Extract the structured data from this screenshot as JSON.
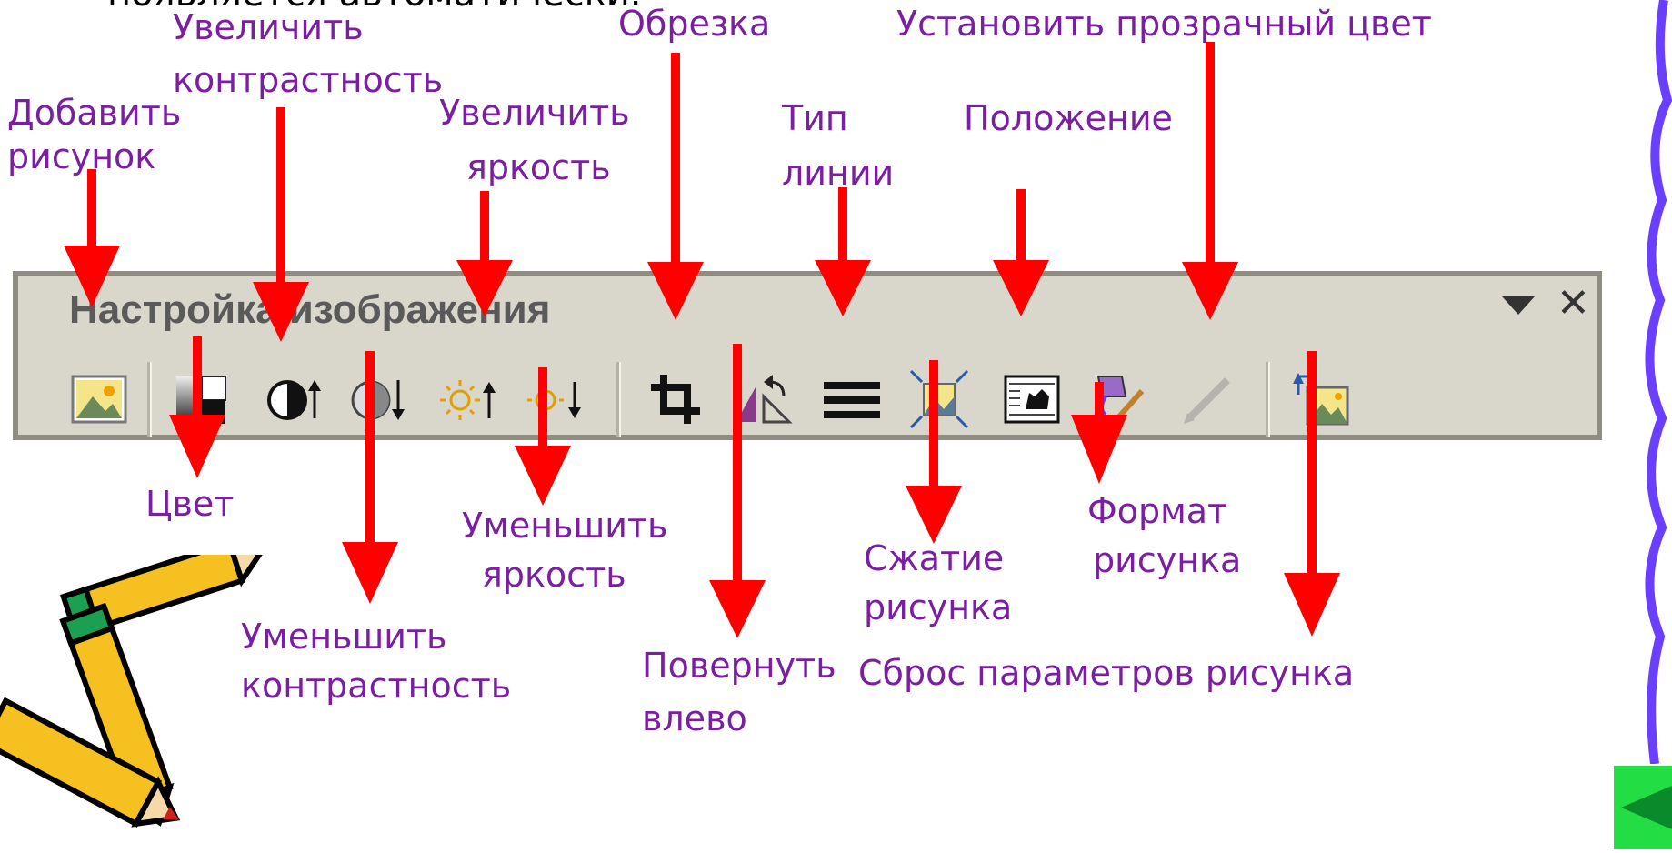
{
  "intro_text": "появляется автоматически.",
  "toolbar": {
    "title": "Настройка изображения",
    "close_glyph": "✕",
    "buttons": [
      {
        "id": "insert-picture",
        "icon": "insert-picture-icon"
      },
      {
        "id": "color",
        "icon": "color-icon"
      },
      {
        "id": "more-contrast",
        "icon": "more-contrast-icon"
      },
      {
        "id": "less-contrast",
        "icon": "less-contrast-icon"
      },
      {
        "id": "more-brightness",
        "icon": "more-brightness-icon"
      },
      {
        "id": "less-brightness",
        "icon": "less-brightness-icon"
      },
      {
        "id": "crop",
        "icon": "crop-icon"
      },
      {
        "id": "rotate-left",
        "icon": "rotate-left-icon"
      },
      {
        "id": "line-style",
        "icon": "line-style-icon"
      },
      {
        "id": "compress-pictures",
        "icon": "compress-pictures-icon"
      },
      {
        "id": "text-wrapping",
        "icon": "text-wrapping-icon"
      },
      {
        "id": "format-picture",
        "icon": "format-picture-icon"
      },
      {
        "id": "set-transparent-color",
        "icon": "set-transparent-color-icon",
        "disabled": true
      },
      {
        "id": "reset-picture",
        "icon": "reset-picture-icon"
      }
    ]
  },
  "labels": {
    "insert_picture": [
      "Добавить",
      "рисунок"
    ],
    "more_contrast": [
      "Увеличить",
      "контрастность"
    ],
    "more_brightness": [
      "Увеличить",
      "яркость"
    ],
    "crop": [
      "Обрезка"
    ],
    "line_style": [
      "Тип",
      "линии"
    ],
    "position": [
      "Положение"
    ],
    "transparent_color": [
      "Установить прозрачный цвет"
    ],
    "color": [
      "Цвет"
    ],
    "less_contrast": [
      "Уменьшить",
      "контрастность"
    ],
    "less_brightness": [
      "Уменьшить",
      "яркость"
    ],
    "rotate_left": [
      "Повернуть",
      "влево"
    ],
    "compress": [
      "Сжатие",
      "рисунка"
    ],
    "format_picture": [
      "Формат",
      "рисунка"
    ],
    "reset_picture": [
      "Сброс параметров рисунка"
    ]
  },
  "colors": {
    "arrow": "#ff0000",
    "label": "#7a1fa2",
    "toolbar_bg": "#d9d7cc",
    "deco_line": "#6a3fff",
    "nav_button": "#22dd44"
  }
}
